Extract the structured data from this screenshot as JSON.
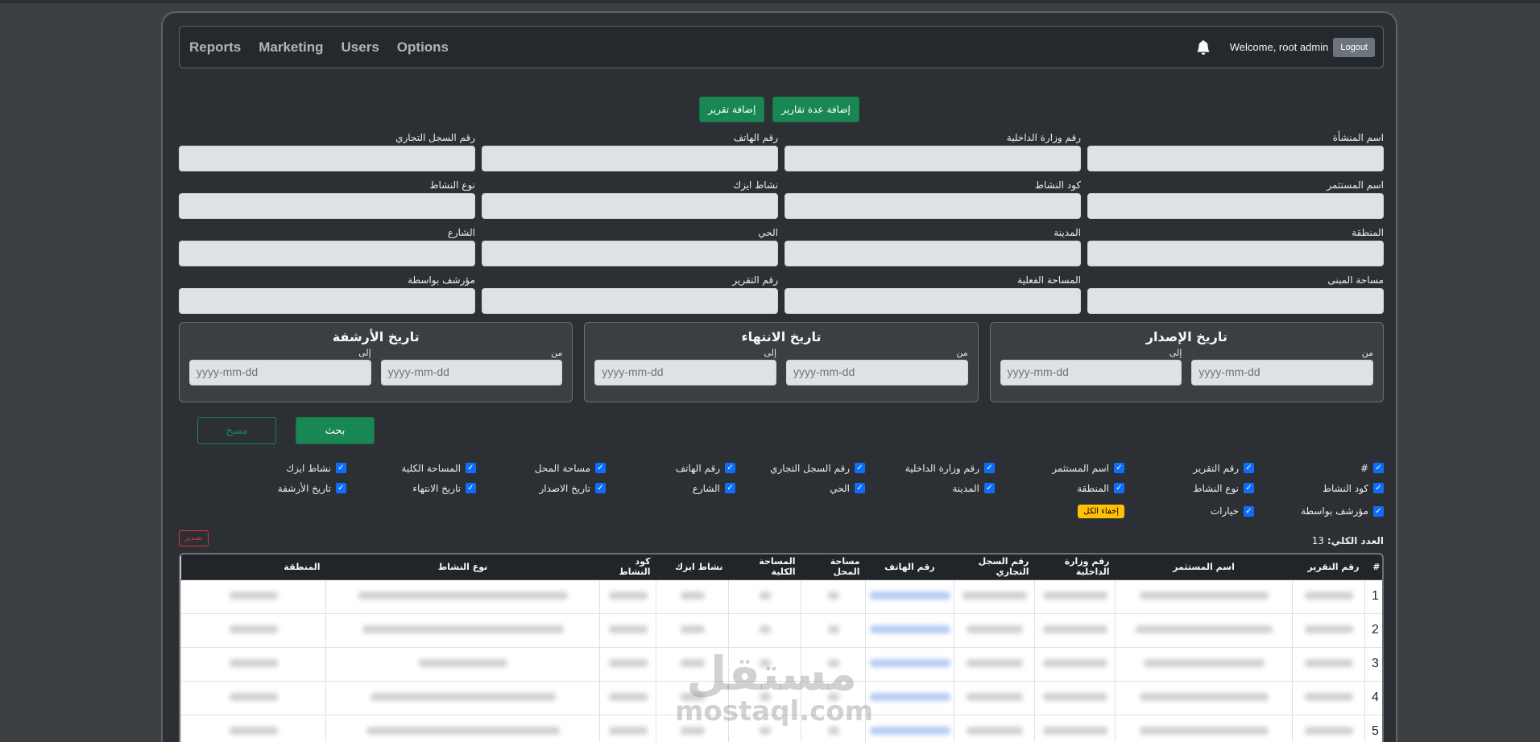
{
  "nav": {
    "links": [
      "Reports",
      "Marketing",
      "Users",
      "Options"
    ],
    "welcome": "Welcome, root admin",
    "logout": "Logout"
  },
  "actions": {
    "add_multiple": "إضافة عدة تقارير",
    "add_one": "إضافة تقرير"
  },
  "fields": [
    "اسم المنشأة",
    "رقم وزارة الداخلية",
    "رقم الهاتف",
    "رقم السجل التجاري",
    "اسم المستثمر",
    "كود النشاط",
    "نشاط ايزك",
    "نوع النشاط",
    "المنطقة",
    "المدينة",
    "الحي",
    "الشارع",
    "مساحة المبنى",
    "المساحة الفعلية",
    "رقم التقرير",
    "مؤرشف بواسطة"
  ],
  "date_filters": [
    {
      "title": "تاريخ الإصدار",
      "from": "من",
      "to": "إلى",
      "placeholder": "yyyy-mm-dd"
    },
    {
      "title": "تاريخ الانتهاء",
      "from": "من",
      "to": "إلى",
      "placeholder": "yyyy-mm-dd"
    },
    {
      "title": "تاريخ الأرشفة",
      "from": "من",
      "to": "إلى",
      "placeholder": "yyyy-mm-dd"
    }
  ],
  "buttons": {
    "search": "بحث",
    "clear": "مسح",
    "hide_all": "إخفاء الكل",
    "export": "تصدير"
  },
  "columns_row1": [
    "#",
    "رقم التقرير",
    "اسم المستثمر",
    "رقم وزارة الداخلية",
    "رقم السجل التجاري",
    "رقم الهاتف",
    "مساحة المحل",
    "المساحة الكلية",
    "نشاط ايزك"
  ],
  "columns_row2": [
    "كود النشاط",
    "نوع النشاط",
    "المنطقة",
    "المدينة",
    "الحي",
    "الشارع",
    "تاريخ الاصدار",
    "تاريخ الانتهاء",
    "تاريخ الأرشفة"
  ],
  "columns_row3": [
    "مؤرشف بواسطة",
    "خيارات"
  ],
  "total": {
    "label": "العدد الكلي:",
    "value": "13"
  },
  "table": {
    "headers": [
      "#",
      "رقم التقرير",
      "اسم المستثمر",
      "رقم وزارة الداخلية",
      "رقم السجل التجاري",
      "رقم الهاتف",
      "مساحة المحل",
      "المساحة الكلية",
      "نشاط ايزك",
      "كود النشاط",
      "نوع النشاط",
      "المنطقة"
    ],
    "row_numbers": [
      "1",
      "2",
      "3",
      "4",
      "5"
    ]
  },
  "watermark": {
    "arabic": "مستقل",
    "latin": "mostaql.com"
  }
}
